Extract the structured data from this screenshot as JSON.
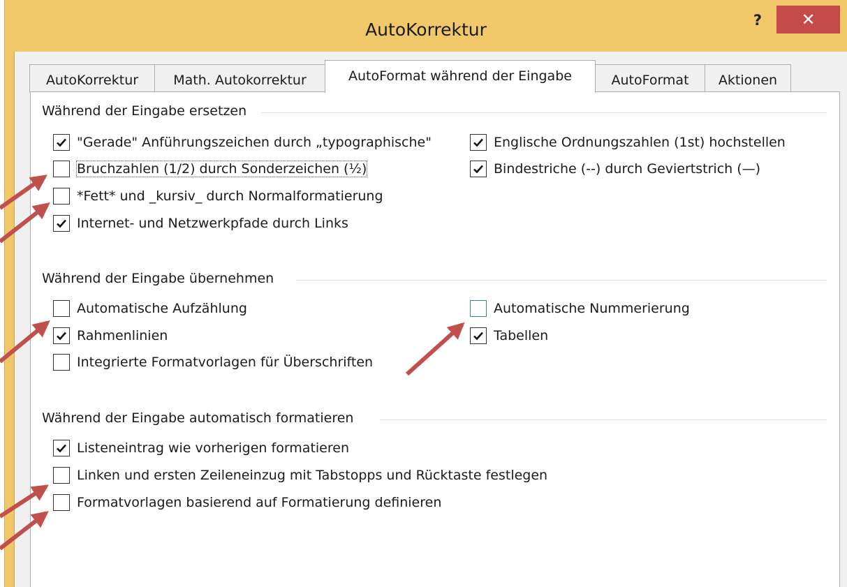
{
  "window": {
    "title": "AutoKorrektur",
    "help_label": "?",
    "close_label": "✕"
  },
  "tabs": [
    {
      "label": "AutoKorrektur",
      "active": false
    },
    {
      "label": "Math. Autokorrektur",
      "active": false
    },
    {
      "label": "AutoFormat während der Eingabe",
      "active": true
    },
    {
      "label": "AutoFormat",
      "active": false
    },
    {
      "label": "Aktionen",
      "active": false
    }
  ],
  "groups": [
    {
      "title": "Während der Eingabe ersetzen",
      "options": [
        {
          "label": "\"Gerade\" Anführungszeichen durch „typographische\"",
          "checked": true
        },
        {
          "label": "Bruchzahlen (1/2) durch Sonderzeichen (½)",
          "checked": false
        },
        {
          "label": "*Fett* und _kursiv_ durch Normalformatierung",
          "checked": false
        },
        {
          "label": "Internet- und Netzwerkpfade durch Links",
          "checked": true
        },
        {
          "label": "Englische Ordnungszahlen (1st) hochstellen",
          "checked": true
        },
        {
          "label": "Bindestriche (--) durch Geviertstrich (—)",
          "checked": true
        }
      ]
    },
    {
      "title": "Während der Eingabe übernehmen",
      "options": [
        {
          "label": "Automatische Aufzählung",
          "checked": false
        },
        {
          "label": "Rahmenlinien",
          "checked": true
        },
        {
          "label": "Integrierte Formatvorlagen für Überschriften",
          "checked": false
        },
        {
          "label": "Automatische Nummerierung",
          "checked": false
        },
        {
          "label": "Tabellen",
          "checked": true
        }
      ]
    },
    {
      "title": "Während der Eingabe automatisch formatieren",
      "options": [
        {
          "label": "Listeneintrag wie vorherigen formatieren",
          "checked": true
        },
        {
          "label": "Linken und ersten Zeileneinzug mit Tabstopps und Rücktaste festlegen",
          "checked": false
        },
        {
          "label": "Formatvorlagen basierend auf Formatierung definieren",
          "checked": false
        }
      ]
    }
  ],
  "colors": {
    "frame": "#f0c86a",
    "close_button": "#c74a4a",
    "annotation_arrow": "#c0504d",
    "focus_box": "#3c7fb1"
  }
}
